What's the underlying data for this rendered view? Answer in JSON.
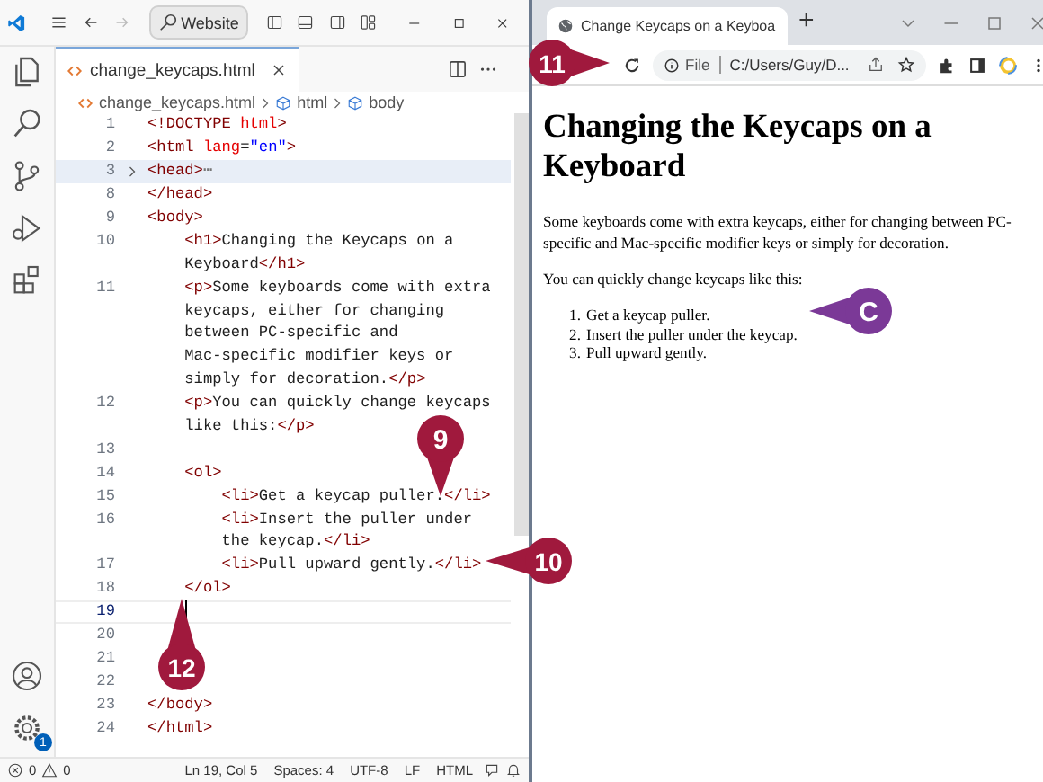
{
  "editor": {
    "search": "Website",
    "tab": "change_keycaps.html",
    "breadcrumb": [
      "change_keycaps.html",
      "html",
      "body"
    ],
    "lines": [
      {
        "number": "1",
        "current": false,
        "tokens": [
          {
            "kind": "tag",
            "text": "<!DOCTYPE "
          },
          {
            "kind": "attr",
            "text": "html"
          },
          {
            "kind": "tag",
            "text": ">"
          }
        ]
      },
      {
        "number": "2",
        "current": false,
        "tokens": [
          {
            "kind": "tag",
            "text": "<html "
          },
          {
            "kind": "attr",
            "text": "lang"
          },
          {
            "kind": "text",
            "text": "="
          },
          {
            "kind": "str",
            "text": "\"en\""
          },
          {
            "kind": "tag",
            "text": ">"
          }
        ]
      },
      {
        "number": "3",
        "current": false,
        "tokens": [
          {
            "kind": "tag",
            "text": "<head>"
          },
          {
            "kind": "fold",
            "text": "⋯"
          }
        ]
      },
      {
        "number": "8",
        "current": false,
        "tokens": [
          {
            "kind": "tag",
            "text": "</head>"
          }
        ]
      },
      {
        "number": "9",
        "current": false,
        "tokens": [
          {
            "kind": "tag",
            "text": "<body>"
          }
        ]
      },
      {
        "number": "10",
        "current": false,
        "tokens": [
          {
            "kind": "tag",
            "text": "    <h1>"
          },
          {
            "kind": "text",
            "text": "Changing the Keycaps on a"
          }
        ]
      },
      {
        "current": false,
        "tokens": [
          {
            "kind": "text",
            "text": "    Keyboard"
          },
          {
            "kind": "tag",
            "text": "</h1>"
          }
        ]
      },
      {
        "number": "11",
        "current": false,
        "tokens": [
          {
            "kind": "tag",
            "text": "    <p>"
          },
          {
            "kind": "text",
            "text": "Some keyboards come with extra"
          }
        ]
      },
      {
        "current": false,
        "tokens": [
          {
            "kind": "text",
            "text": "    keycaps, either for changing"
          }
        ]
      },
      {
        "current": false,
        "tokens": [
          {
            "kind": "text",
            "text": "    between PC-specific and"
          }
        ]
      },
      {
        "current": false,
        "tokens": [
          {
            "kind": "text",
            "text": "    Mac-specific modifier keys or"
          }
        ]
      },
      {
        "current": false,
        "tokens": [
          {
            "kind": "text",
            "text": "    simply for decoration."
          },
          {
            "kind": "tag",
            "text": "</p>"
          }
        ]
      },
      {
        "number": "12",
        "current": false,
        "tokens": [
          {
            "kind": "tag",
            "text": "    <p>"
          },
          {
            "kind": "text",
            "text": "You can quickly change keycaps"
          }
        ]
      },
      {
        "current": false,
        "tokens": [
          {
            "kind": "text",
            "text": "    like this:"
          },
          {
            "kind": "tag",
            "text": "</p>"
          }
        ]
      },
      {
        "number": "13",
        "current": false
      },
      {
        "number": "14",
        "current": false,
        "tokens": [
          {
            "kind": "tag",
            "text": "    <ol>"
          }
        ]
      },
      {
        "number": "15",
        "current": false,
        "tokens": [
          {
            "kind": "tag",
            "text": "        <li>"
          },
          {
            "kind": "text",
            "text": "Get a keycap puller."
          },
          {
            "kind": "tag",
            "text": "</li>"
          }
        ]
      },
      {
        "number": "16",
        "current": false,
        "tokens": [
          {
            "kind": "tag",
            "text": "        <li>"
          },
          {
            "kind": "text",
            "text": "Insert the puller under"
          }
        ]
      },
      {
        "current": false,
        "tokens": [
          {
            "kind": "text",
            "text": "        the keycap."
          },
          {
            "kind": "tag",
            "text": "</li>"
          }
        ]
      },
      {
        "number": "17",
        "current": false,
        "tokens": [
          {
            "kind": "tag",
            "text": "        <li>"
          },
          {
            "kind": "text",
            "text": "Pull upward gently."
          },
          {
            "kind": "tag",
            "text": "</li>"
          }
        ]
      },
      {
        "number": "18",
        "current": false,
        "tokens": [
          {
            "kind": "tag",
            "text": "    </ol>"
          }
        ]
      },
      {
        "number": "19",
        "current": true
      },
      {
        "number": "20",
        "current": false
      },
      {
        "number": "21",
        "current": false
      },
      {
        "number": "22",
        "current": false
      },
      {
        "number": "23",
        "current": false,
        "tokens": [
          {
            "kind": "tag",
            "text": "</body>"
          }
        ]
      },
      {
        "number": "24",
        "current": false,
        "tokens": [
          {
            "kind": "tag",
            "text": "</html>"
          }
        ]
      }
    ],
    "settings_badge": "1",
    "status_bar": {
      "errors": "0",
      "warnings": "0",
      "items": [
        "Ln 19, Col 5",
        "Spaces: 4",
        "UTF-8",
        "LF",
        "HTML"
      ]
    }
  },
  "browser": {
    "tab": "Change Keycaps on a Keyboa",
    "new_tab": "+",
    "scheme": "File",
    "address": "C:/Users/Guy/D...",
    "page": {
      "heading": "Changing the Keycaps on a Keyboard",
      "paragraphs": [
        "Some keyboards come with extra keycaps, either for changing between PC-specific and Mac-specific modifier keys or simply for decoration.",
        "You can quickly change keycaps like this:"
      ],
      "list": [
        {
          "number": "1.",
          "text": "Get a keycap puller."
        },
        {
          "number": "2.",
          "text": "Insert the puller under the keycap."
        },
        {
          "number": "3.",
          "text": "Pull upward gently."
        }
      ]
    }
  },
  "callouts": [
    {
      "label": "11",
      "color": "#a0193d"
    },
    {
      "label": "9",
      "color": "#a0193d"
    },
    {
      "label": "10",
      "color": "#a0193d"
    },
    {
      "label": "12",
      "color": "#a0193d"
    },
    {
      "label": "C",
      "color": "#7b3997"
    }
  ]
}
